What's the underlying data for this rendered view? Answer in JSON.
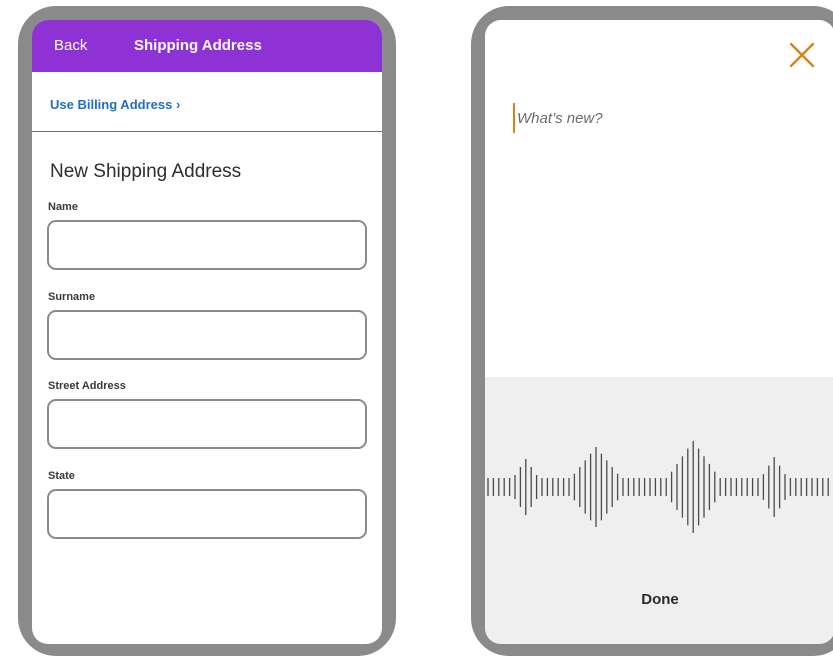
{
  "shipping": {
    "back_label": "Back",
    "title": "Shipping Address",
    "billing_link": "Use Billing Address ›",
    "form_title": "New Shipping Address",
    "fields": [
      {
        "label": "Name",
        "value": ""
      },
      {
        "label": "Surname",
        "value": ""
      },
      {
        "label": "Street Address",
        "value": ""
      },
      {
        "label": "State",
        "value": ""
      }
    ]
  },
  "voice": {
    "compose_placeholder": "What’s new?",
    "done_label": "Done",
    "close_icon": "close-icon"
  },
  "colors": {
    "nav_bar": "#8e32d6",
    "link": "#1f6fc4",
    "accent": "#d9821d",
    "frame": "#8a8a8a"
  }
}
